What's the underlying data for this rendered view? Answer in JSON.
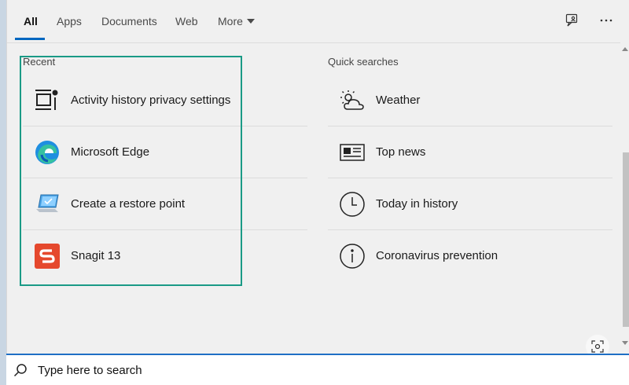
{
  "tabs": [
    {
      "label": "All",
      "active": true
    },
    {
      "label": "Apps"
    },
    {
      "label": "Documents"
    },
    {
      "label": "Web"
    },
    {
      "label": "More"
    }
  ],
  "recent": {
    "title": "Recent",
    "items": [
      {
        "label": "Activity history privacy settings",
        "icon": "activity-history-icon"
      },
      {
        "label": "Microsoft Edge",
        "icon": "edge-icon"
      },
      {
        "label": "Create a restore point",
        "icon": "restore-point-icon"
      },
      {
        "label": "Snagit 13",
        "icon": "snagit-icon"
      }
    ]
  },
  "quick": {
    "title": "Quick searches",
    "items": [
      {
        "label": "Weather",
        "icon": "weather-icon"
      },
      {
        "label": "Top news",
        "icon": "news-icon"
      },
      {
        "label": "Today in history",
        "icon": "clock-icon"
      },
      {
        "label": "Coronavirus prevention",
        "icon": "info-icon"
      }
    ]
  },
  "search": {
    "placeholder": "Type here to search"
  },
  "colors": {
    "accent": "#0067c0",
    "highlight": "#1a9a86",
    "edge": "#1f8fe0",
    "snagit": "#e5482d"
  }
}
